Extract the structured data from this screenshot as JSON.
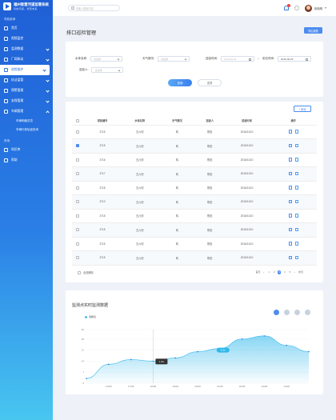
{
  "app": {
    "title": "福州智慧河道监管系统",
    "subtitle": "科技河道，智慧未来"
  },
  "sidebar": {
    "section1": "导航菜单",
    "items": [
      {
        "label": "首页",
        "chev": false
      },
      {
        "label": "视频监控",
        "chev": false
      },
      {
        "label": "监测数据",
        "chev": true
      },
      {
        "label": "厂网联动",
        "chev": true
      },
      {
        "label": "巡检维护",
        "chev": true,
        "active": true
      },
      {
        "label": "执法监管",
        "chev": true
      },
      {
        "label": "预警管理",
        "chev": true
      },
      {
        "label": "安保管理",
        "chev": true
      },
      {
        "label": "车辆管理",
        "chev": true,
        "open": true
      }
    ],
    "subitems": [
      "车辆明细总览",
      "车辆行驶轨迹查询"
    ],
    "section2": "其他",
    "others": [
      "知识库",
      "帮助"
    ]
  },
  "topbar": {
    "search_placeholder": "请输入搜索内容",
    "user": "张晓明"
  },
  "page": {
    "title": "排口巡检管理",
    "export": "导出报表"
  },
  "filters": {
    "f1": {
      "label": "水体名称:",
      "value": "请选择"
    },
    "f2": {
      "label": "天气情况:",
      "value": "请选择"
    },
    "f3": {
      "label": "巡检时间:",
      "start": "2016-06-26",
      "sep": "~",
      "end_label": "到达时间:",
      "end": "2016-06-26"
    },
    "f4": {
      "label": "巡检人:",
      "value": "请选择"
    },
    "query": "查询",
    "reset": "重置"
  },
  "table": {
    "add": "+ 新增",
    "headers": [
      "排放编号",
      "水体名称",
      "天气情况",
      "巡检人",
      "巡检时间",
      "操作"
    ],
    "rows": [
      {
        "no": "3715",
        "water": "五六河",
        "weather": "晴",
        "person": "陈忠",
        "date": "2016/11/10",
        "checked": false
      },
      {
        "no": "3715",
        "water": "五六河",
        "weather": "晴",
        "person": "陈忠",
        "date": "2016/11/10",
        "checked": true
      },
      {
        "no": "3716",
        "water": "五六河",
        "weather": "晴",
        "person": "陈忠",
        "date": "2016/11/10",
        "checked": false
      },
      {
        "no": "3717",
        "water": "五六河",
        "weather": "晴",
        "person": "陈忠",
        "date": "2016/11/10",
        "checked": false
      },
      {
        "no": "3718",
        "water": "五六河",
        "weather": "晴",
        "person": "陈忠",
        "date": "2016/11/10",
        "checked": false
      },
      {
        "no": "3713",
        "water": "五六河",
        "weather": "晴",
        "person": "陈忠",
        "date": "2016/11/10",
        "checked": false
      },
      {
        "no": "3715",
        "water": "五六河",
        "weather": "晴",
        "person": "陈忠",
        "date": "2016/11/10",
        "checked": false
      },
      {
        "no": "3715",
        "water": "五六河",
        "weather": "晴",
        "person": "陈忠",
        "date": "2016/11/10",
        "checked": false
      },
      {
        "no": "3715",
        "water": "五六河",
        "weather": "晴",
        "person": "陈忠",
        "date": "2016/11/10",
        "checked": false
      },
      {
        "no": "3715",
        "water": "五六河",
        "weather": "晴",
        "person": "陈忠",
        "date": "2016/11/10",
        "checked": false
      }
    ],
    "select_all": "全选删除",
    "pager": {
      "prev_label": "首页",
      "pages": [
        "1",
        "2",
        "3",
        "4",
        "5"
      ],
      "current": "3",
      "next_label": "末页"
    }
  },
  "chart_section": {
    "title": "监测点实时监测数据"
  },
  "chart_data": {
    "type": "area",
    "series": [
      {
        "name": "溶解氧",
        "color": "#48c0ee"
      }
    ],
    "x": [
      "",
      "10/08",
      "17/08",
      "18/08",
      "19/08",
      "20/08",
      "21/08",
      "22/08",
      "23/08",
      "24/08",
      ""
    ],
    "values": [
      3,
      12,
      15,
      14,
      16,
      20,
      22,
      28,
      30,
      24,
      20
    ],
    "yticks": [
      0,
      7,
      14,
      21,
      28,
      34
    ],
    "ylim": [
      0,
      34
    ],
    "tooltip": {
      "index": 3,
      "text": "1.0m"
    },
    "marker": {
      "index": 6,
      "text": "3.2m"
    }
  }
}
